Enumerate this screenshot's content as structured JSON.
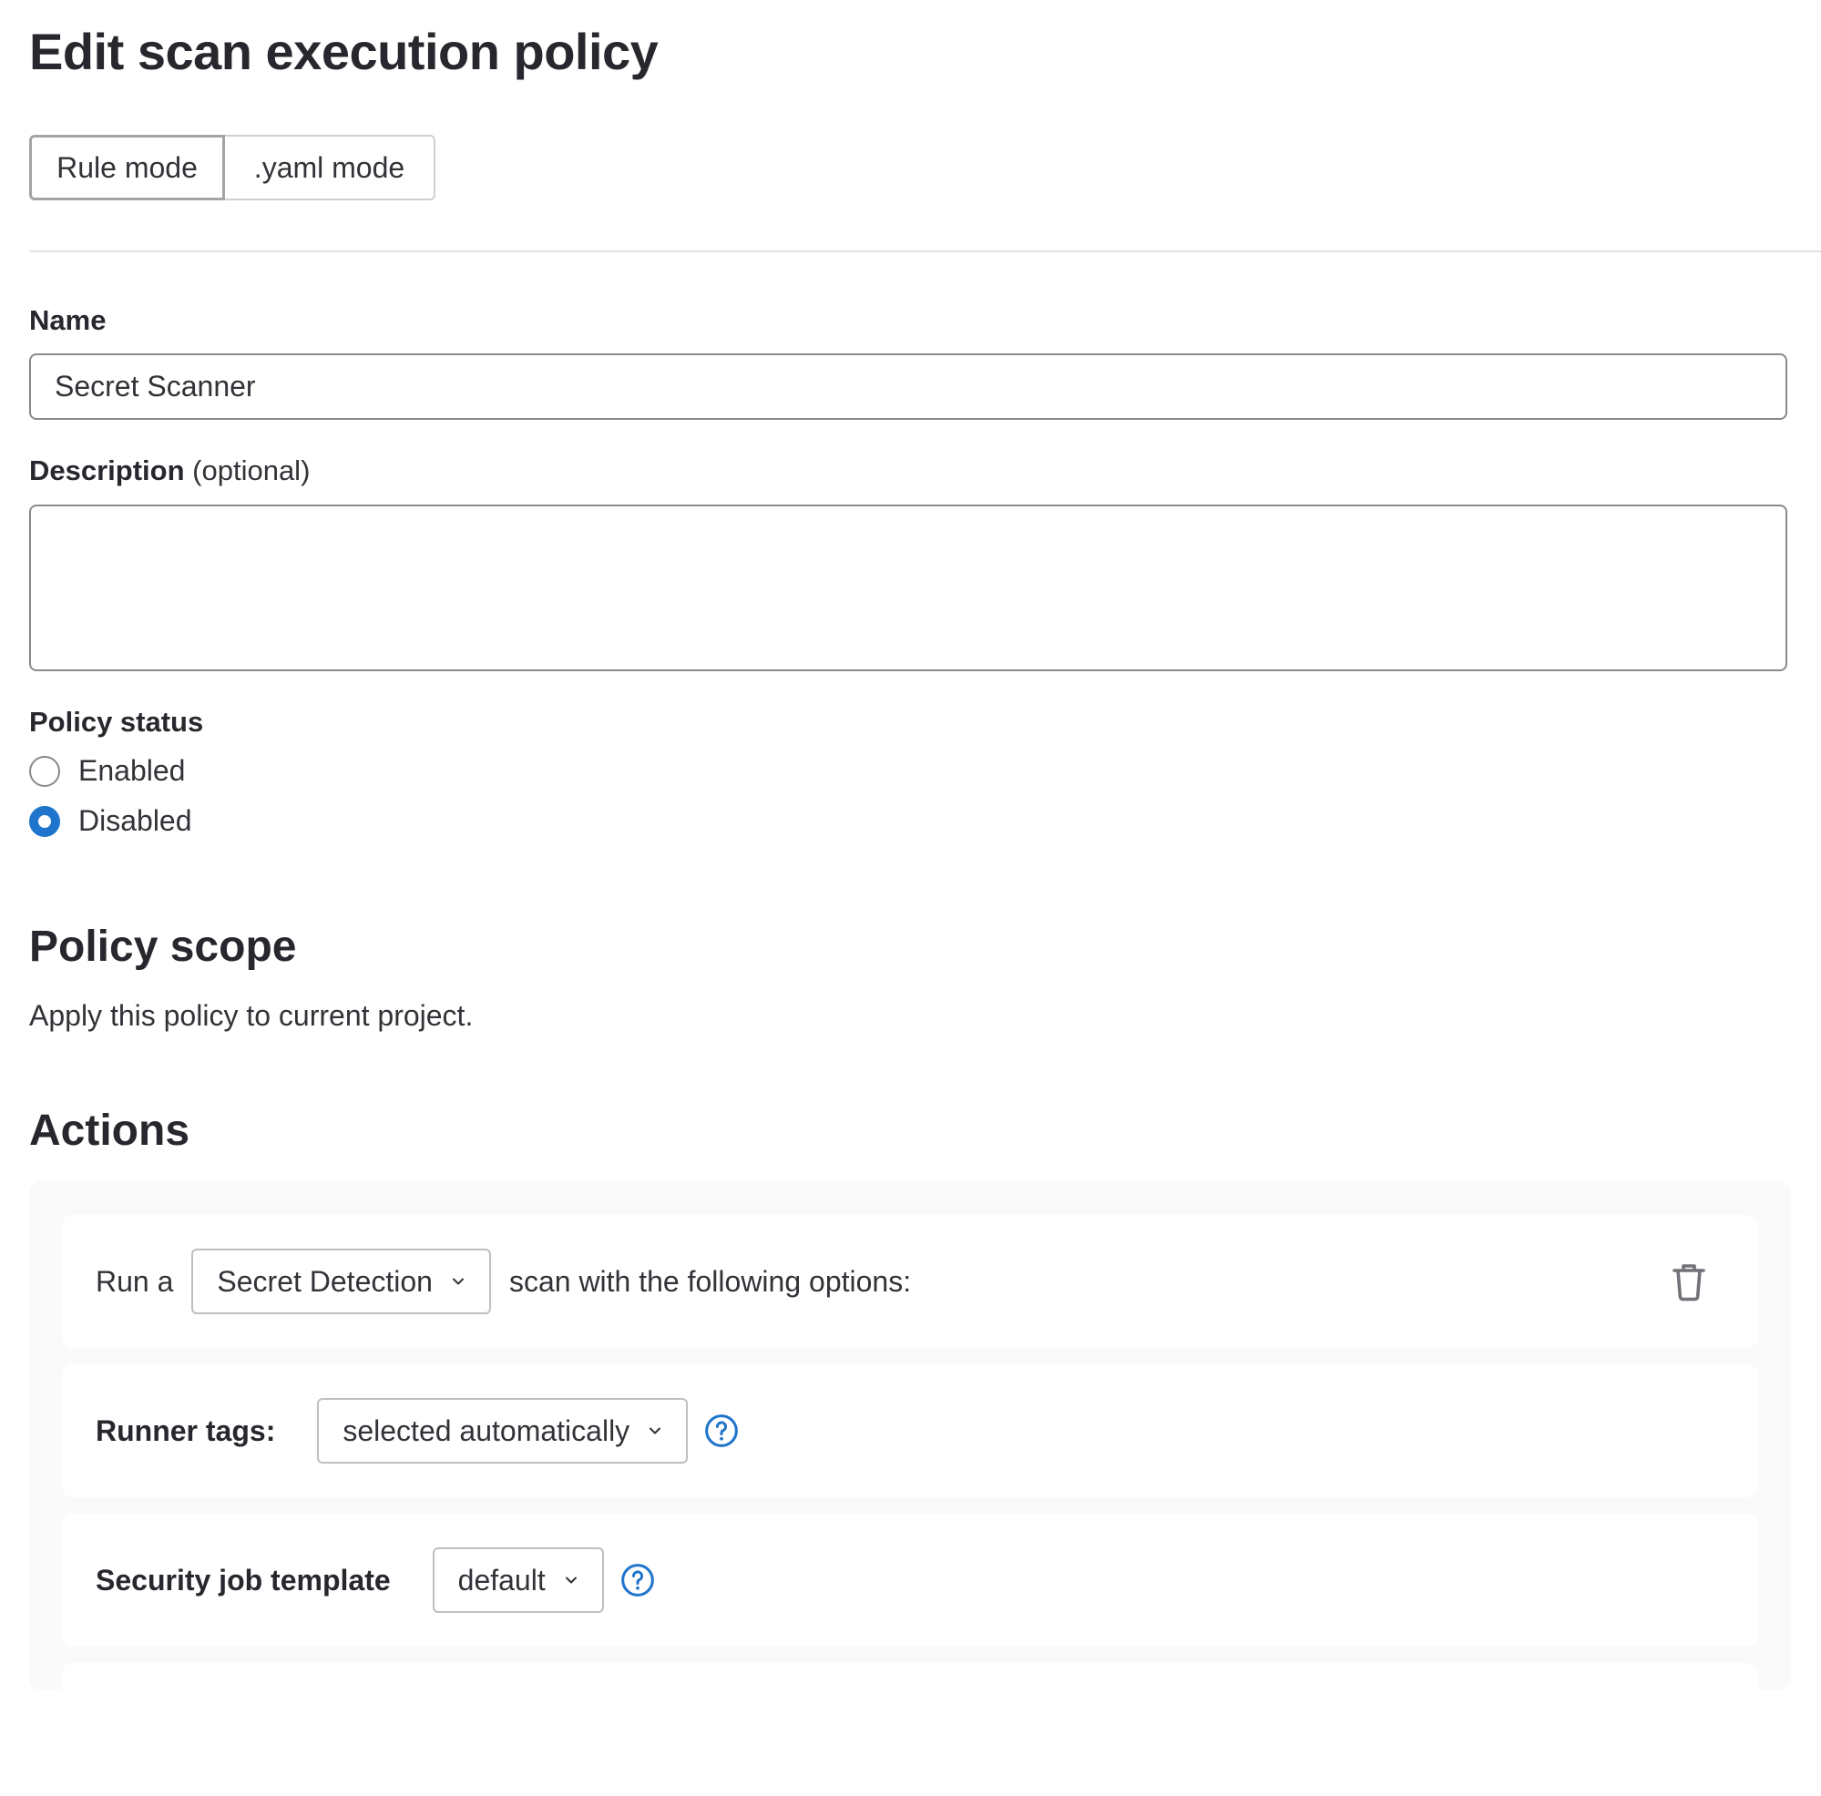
{
  "page": {
    "title": "Edit scan execution policy"
  },
  "mode_toggle": {
    "options": [
      {
        "label": "Rule mode",
        "selected": true
      },
      {
        "label": ".yaml mode",
        "selected": false
      }
    ]
  },
  "form": {
    "name": {
      "label": "Name",
      "value": "Secret Scanner"
    },
    "description": {
      "label": "Description",
      "optional_suffix": "(optional)",
      "value": ""
    },
    "policy_status": {
      "label": "Policy status",
      "options": [
        {
          "label": "Enabled",
          "checked": false
        },
        {
          "label": "Disabled",
          "checked": true
        }
      ]
    }
  },
  "policy_scope": {
    "heading": "Policy scope",
    "text": "Apply this policy to current project."
  },
  "actions": {
    "heading": "Actions",
    "scan_row": {
      "prefix": "Run a",
      "scan_type": "Secret Detection",
      "suffix": "scan with the following options:",
      "delete_icon": "trash-icon"
    },
    "runner_tags": {
      "label": "Runner tags:",
      "value": "selected automatically",
      "help_icon": "question-circle-icon"
    },
    "job_template": {
      "label": "Security job template",
      "value": "default",
      "help_icon": "question-circle-icon"
    }
  },
  "colors": {
    "accent": "#1f75cb",
    "text": "#333238",
    "heading": "#28272d",
    "panel_bg": "#fafafb",
    "border": "#89888d"
  }
}
